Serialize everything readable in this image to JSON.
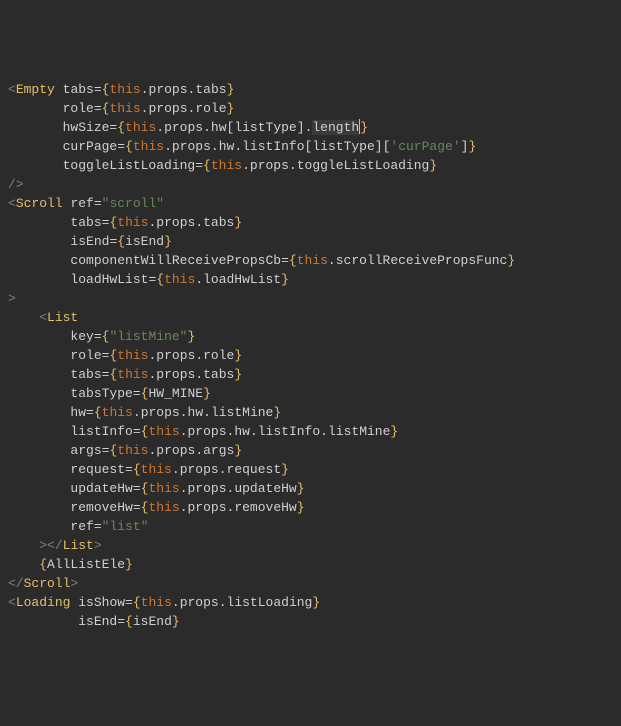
{
  "language": "JSX",
  "code": {
    "lines": [
      {
        "indent": 0,
        "raw": "<Empty tabs={this.props.tabs}"
      },
      {
        "indent": 7,
        "raw": "role={this.props.role}"
      },
      {
        "indent": 7,
        "raw": "hwSize={this.props.hw[listType].length}"
      },
      {
        "indent": 7,
        "raw": "curPage={this.props.hw.listInfo[listType]['curPage']}"
      },
      {
        "indent": 7,
        "raw": "toggleListLoading={this.props.toggleListLoading}"
      },
      {
        "indent": 0,
        "raw": "/>"
      },
      {
        "indent": 0,
        "raw": "<Scroll ref=\"scroll\""
      },
      {
        "indent": 8,
        "raw": "tabs={this.props.tabs}"
      },
      {
        "indent": 8,
        "raw": "isEnd={isEnd}"
      },
      {
        "indent": 8,
        "raw": "componentWillReceivePropsCb={this.scrollReceivePropsFunc}"
      },
      {
        "indent": 8,
        "raw": "loadHwList={this.loadHwList}"
      },
      {
        "indent": 0,
        "raw": ">"
      },
      {
        "indent": 4,
        "raw": "<List"
      },
      {
        "indent": 8,
        "raw": "key={\"listMine\"}"
      },
      {
        "indent": 8,
        "raw": "role={this.props.role}"
      },
      {
        "indent": 8,
        "raw": "tabs={this.props.tabs}"
      },
      {
        "indent": 8,
        "raw": "tabsType={HW_MINE}"
      },
      {
        "indent": 8,
        "raw": "hw={this.props.hw.listMine}"
      },
      {
        "indent": 8,
        "raw": "listInfo={this.props.hw.listInfo.listMine}"
      },
      {
        "indent": 8,
        "raw": "args={this.props.args}"
      },
      {
        "indent": 8,
        "raw": "request={this.props.request}"
      },
      {
        "indent": 8,
        "raw": "updateHw={this.props.updateHw}"
      },
      {
        "indent": 8,
        "raw": "removeHw={this.props.removeHw}"
      },
      {
        "indent": 8,
        "raw": "ref=\"list\""
      },
      {
        "indent": 4,
        "raw": "></List>"
      },
      {
        "indent": 4,
        "raw": "{AllListEle}"
      },
      {
        "indent": 0,
        "raw": "</Scroll>"
      },
      {
        "indent": 0,
        "raw": "<Loading isShow={this.props.listLoading}"
      },
      {
        "indent": 9,
        "raw": "isEnd={isEnd}"
      }
    ]
  },
  "cursor": {
    "line": 2,
    "after": "length"
  },
  "highlight": {
    "line": 2,
    "token": "length"
  },
  "colors": {
    "background": "#2b2b2b",
    "tag": "#e8bf6a",
    "string": "#6a8759",
    "keyword": "#cc7832",
    "member": "#9876aa",
    "default": "#d0d0d0",
    "bracket": "#808080"
  }
}
